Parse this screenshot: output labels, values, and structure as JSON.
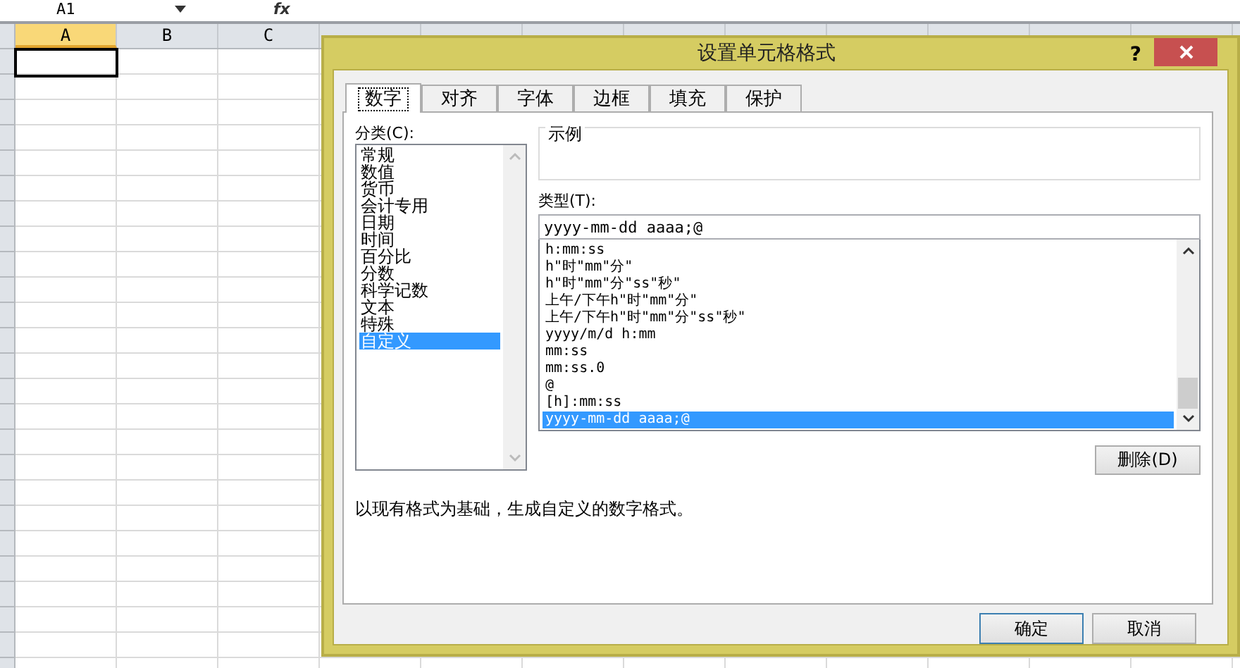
{
  "formula_bar": {
    "name_box": "A1",
    "function_label": "fx"
  },
  "sheet": {
    "columns": [
      {
        "label": "A",
        "selected": true
      },
      {
        "label": "B",
        "selected": false
      },
      {
        "label": "C",
        "selected": false
      }
    ]
  },
  "dialog": {
    "title": "设置单元格格式",
    "help": "?",
    "tabs": [
      {
        "label": "数字",
        "selected": true
      },
      {
        "label": "对齐",
        "selected": false
      },
      {
        "label": "字体",
        "selected": false
      },
      {
        "label": "边框",
        "selected": false
      },
      {
        "label": "填充",
        "selected": false
      },
      {
        "label": "保护",
        "selected": false
      }
    ],
    "category_label": "分类(C):",
    "categories": [
      {
        "label": "常规",
        "selected": false
      },
      {
        "label": "数值",
        "selected": false
      },
      {
        "label": "货币",
        "selected": false
      },
      {
        "label": "会计专用",
        "selected": false
      },
      {
        "label": "日期",
        "selected": false
      },
      {
        "label": "时间",
        "selected": false
      },
      {
        "label": "百分比",
        "selected": false
      },
      {
        "label": "分数",
        "selected": false
      },
      {
        "label": "科学记数",
        "selected": false
      },
      {
        "label": "文本",
        "selected": false
      },
      {
        "label": "特殊",
        "selected": false
      },
      {
        "label": "自定义",
        "selected": true
      }
    ],
    "sample_label": "示例",
    "type_label": "类型(T):",
    "type_value": "yyyy-mm-dd aaaa;@",
    "formats": [
      {
        "label": "h:mm:ss",
        "selected": false
      },
      {
        "label": "h\"时\"mm\"分\"",
        "selected": false
      },
      {
        "label": "h\"时\"mm\"分\"ss\"秒\"",
        "selected": false
      },
      {
        "label": "上午/下午h\"时\"mm\"分\"",
        "selected": false
      },
      {
        "label": "上午/下午h\"时\"mm\"分\"ss\"秒\"",
        "selected": false
      },
      {
        "label": "yyyy/m/d h:mm",
        "selected": false
      },
      {
        "label": "mm:ss",
        "selected": false
      },
      {
        "label": "mm:ss.0",
        "selected": false
      },
      {
        "label": "@",
        "selected": false
      },
      {
        "label": "[h]:mm:ss",
        "selected": false
      },
      {
        "label": "yyyy-mm-dd aaaa;@",
        "selected": true
      }
    ],
    "delete_button": "删除(D)",
    "description": "以现有格式为基础，生成自定义的数字格式。",
    "buttons": [
      {
        "label": "确定",
        "kind": "default"
      },
      {
        "label": "取消",
        "kind": "normal"
      }
    ]
  }
}
